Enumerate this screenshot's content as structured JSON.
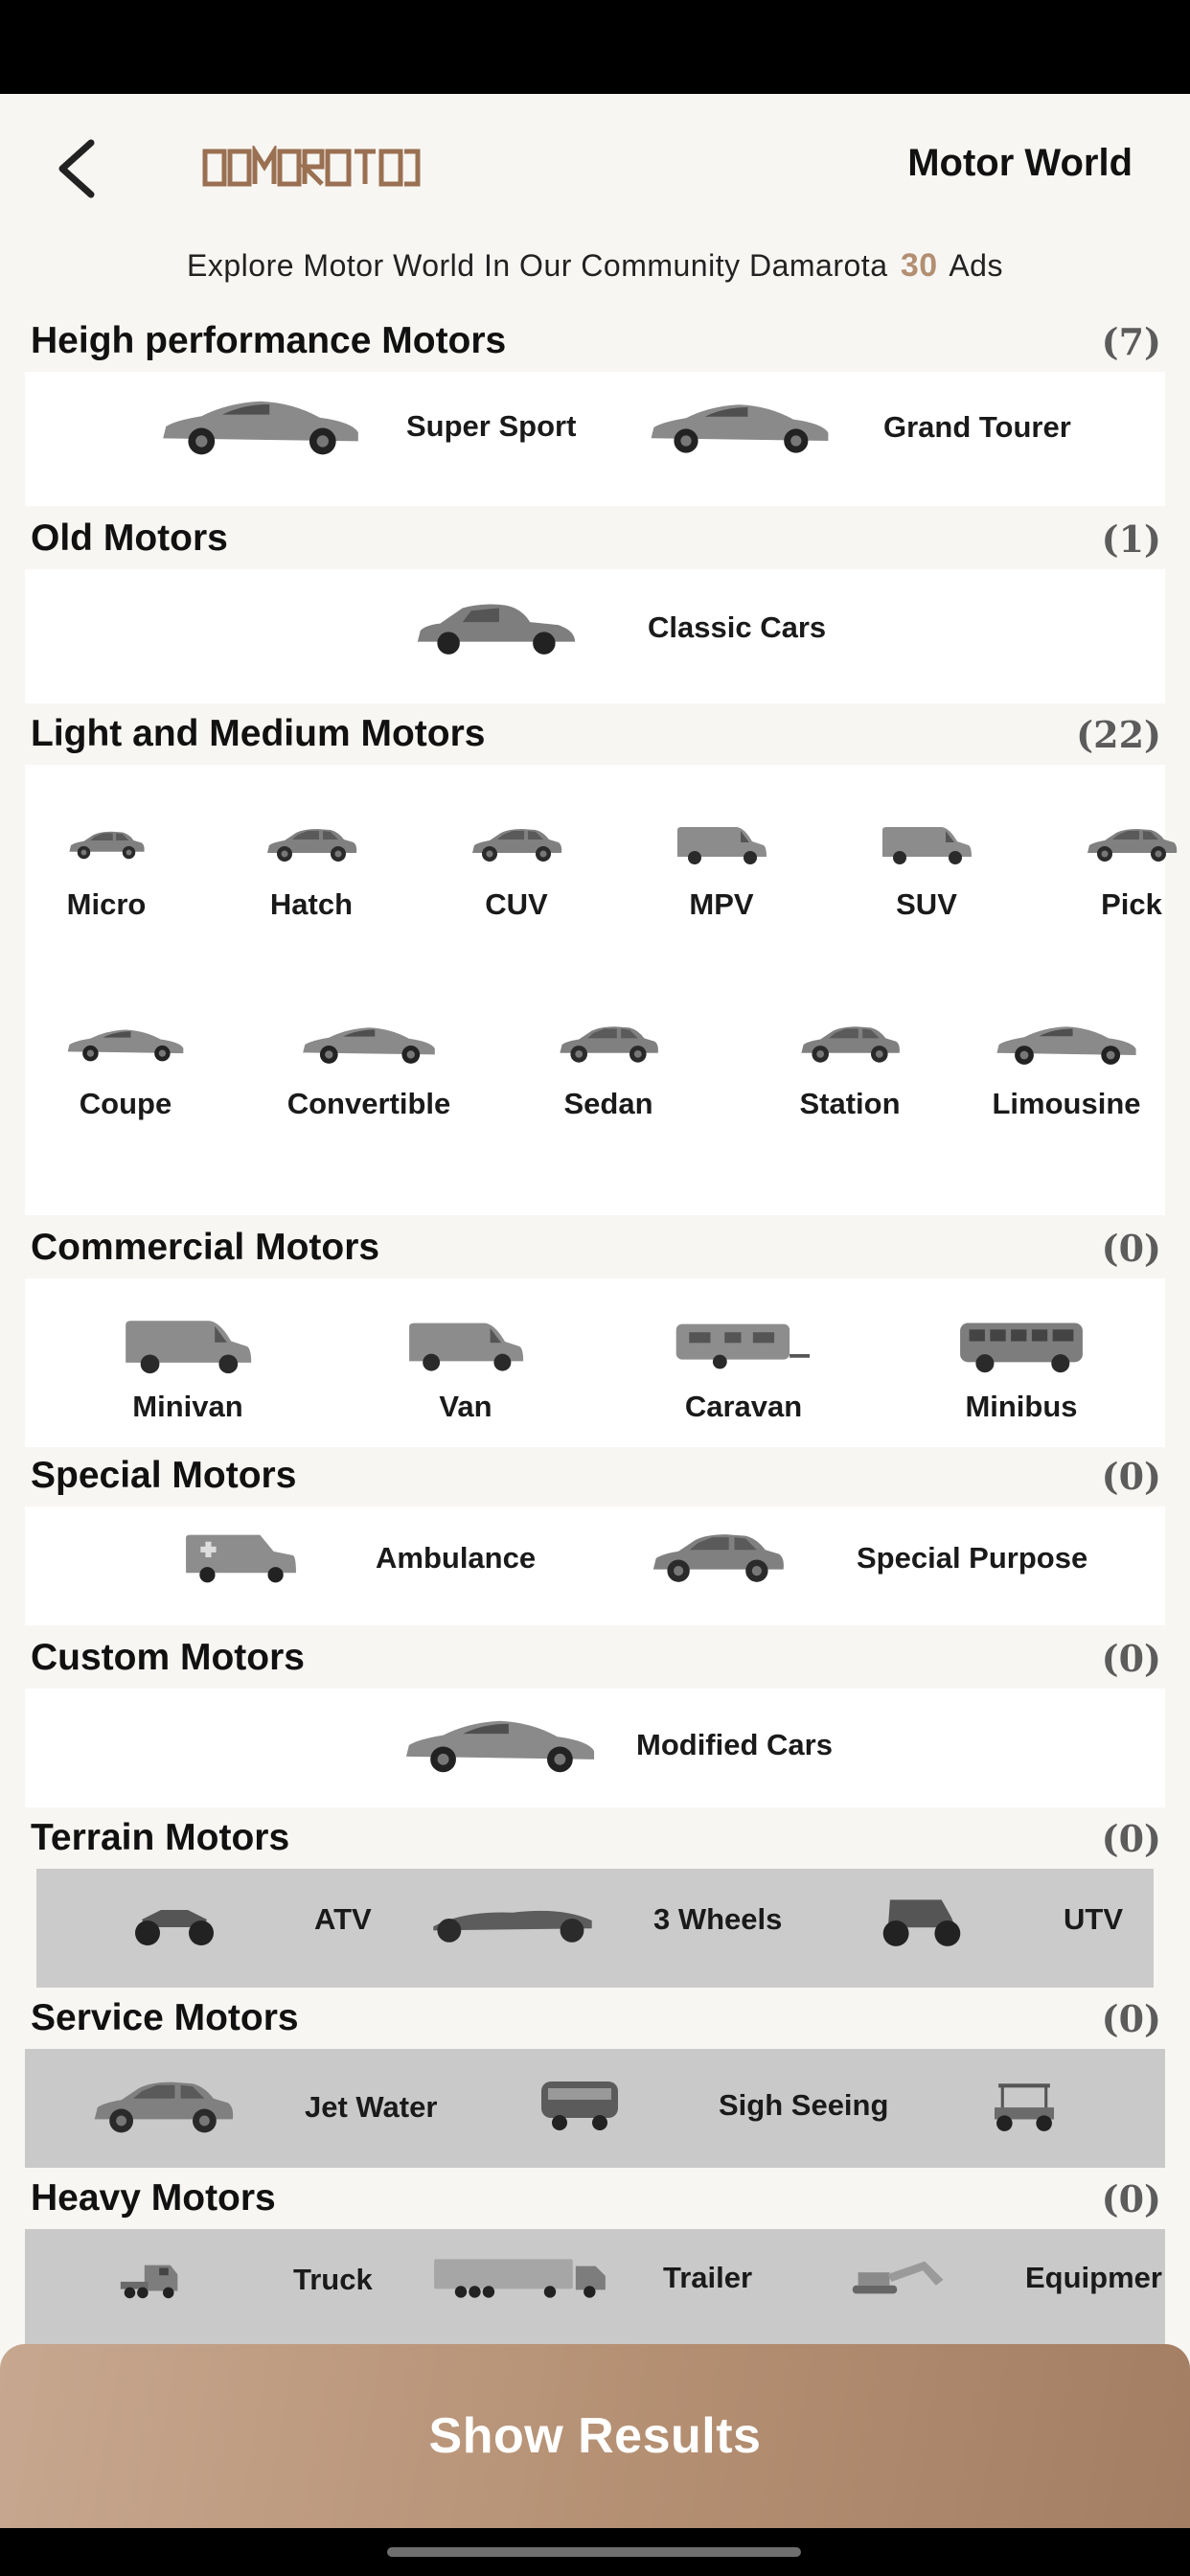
{
  "header": {
    "title": "Motor World",
    "logo_text": "DAMAROTA"
  },
  "explore": {
    "prefix": "Explore Motor World In Our Community Damarota",
    "count": "30",
    "suffix": "Ads"
  },
  "sections": {
    "high_performance": {
      "title": "Heigh performance Motors",
      "count": "(7)",
      "items": [
        "Super Sport",
        "Grand Tourer"
      ]
    },
    "old": {
      "title": "Old Motors",
      "count": "(1)",
      "items": [
        "Classic Cars"
      ]
    },
    "light_medium": {
      "title": "Light and Medium Motors",
      "count": "(22)",
      "items": [
        "Micro",
        "Hatch",
        "CUV",
        "MPV",
        "SUV",
        "Pick",
        "Coupe",
        "Convertible",
        "Sedan",
        "Station",
        "Limousine"
      ]
    },
    "commercial": {
      "title": "Commercial Motors",
      "count": "(0)",
      "items": [
        "Minivan",
        "Van",
        "Caravan",
        "Minibus"
      ]
    },
    "special": {
      "title": "Special Motors",
      "count": "(0)",
      "items": [
        "Ambulance",
        "Special Purpose"
      ]
    },
    "custom": {
      "title": "Custom Motors",
      "count": "(0)",
      "items": [
        "Modified Cars"
      ]
    },
    "terrain": {
      "title": "Terrain Motors",
      "count": "(0)",
      "items": [
        "ATV",
        "3 Wheels",
        "UTV"
      ]
    },
    "service": {
      "title": "Service Motors",
      "count": "(0)",
      "items": [
        "Jet Water",
        "Sigh Seeing"
      ]
    },
    "heavy": {
      "title": "Heavy Motors",
      "count": "(0)",
      "items": [
        "Truck",
        "Trailer",
        "Equipmer"
      ]
    }
  },
  "footer": {
    "button_label": "Show Results"
  },
  "colors": {
    "accent": "#b28f72",
    "button_start": "#c7a78f",
    "button_end": "#a47e63",
    "icon_grey": "#7a7a7a"
  }
}
